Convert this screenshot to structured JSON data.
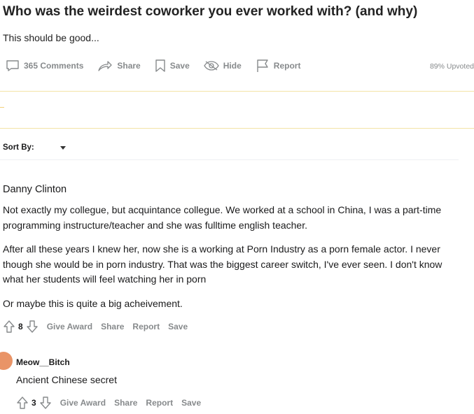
{
  "post": {
    "title": "Who was the weirdest coworker you ever worked with? (and why)",
    "body": "This should be good...",
    "actions": {
      "comments": "365 Comments",
      "share": "Share",
      "save": "Save",
      "hide": "Hide",
      "report": "Report"
    },
    "upvoted": "89% Upvoted"
  },
  "sort": {
    "label": "Sort By:"
  },
  "comments": [
    {
      "author": "Danny Clinton",
      "paragraphs": [
        "Not exactly my collegue, but acquintance collegue. We worked at a school in China, I was a part-time programming instructure/teacher and she was fulltime english teacher.",
        "After all these years I knew her, now she is a working at Porn Industry as a porn female actor. I never though she would be in porn industry. That was the biggest career switch, I've ever seen. I don't know what her students will feel watching her in porn",
        "Or maybe this is quite a big acheivement."
      ],
      "votes": "8",
      "actions": {
        "award": "Give Award",
        "share": "Share",
        "report": "Report",
        "save": "Save"
      },
      "reply": {
        "author": "Meow__Bitch",
        "text": "Ancient Chinese secret",
        "votes": "3",
        "actions": {
          "award": "Give Award",
          "share": "Share",
          "report": "Report",
          "save": "Save"
        }
      }
    }
  ]
}
